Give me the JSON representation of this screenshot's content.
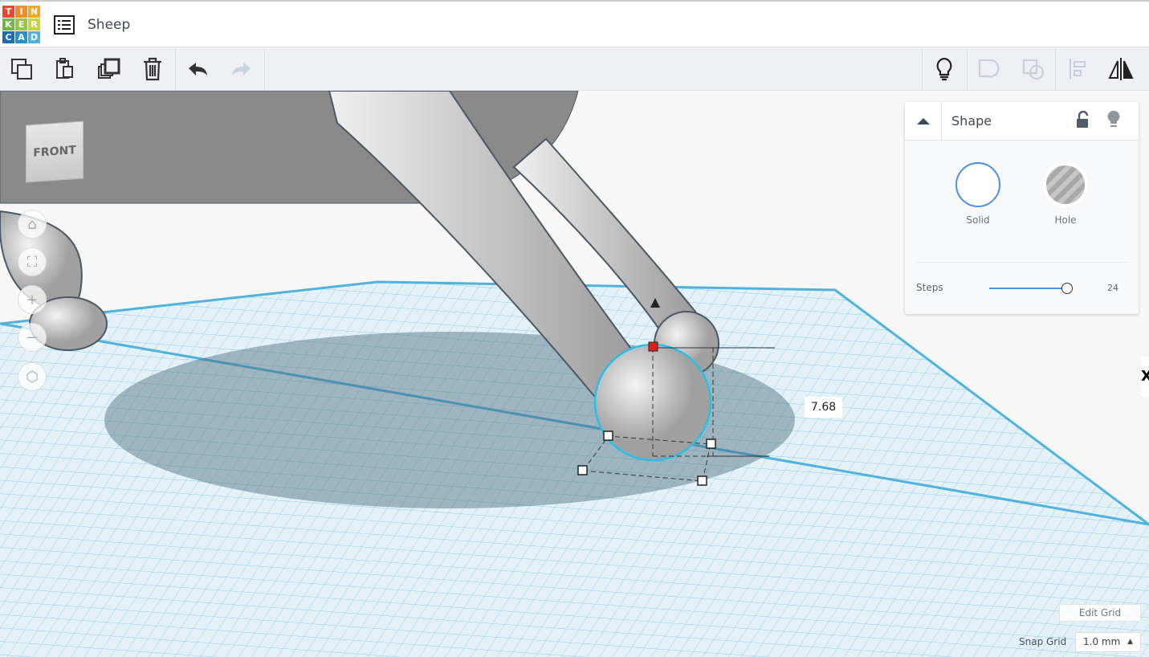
{
  "app": {
    "logo_letters": [
      "T",
      "I",
      "N",
      "K",
      "E",
      "R",
      "C",
      "A",
      "D"
    ],
    "logo_colors": [
      "#e8472b",
      "#f28b2c",
      "#f5a623",
      "#6cb944",
      "#97c83f",
      "#c8d43a",
      "#1c6db6",
      "#2e8bcc",
      "#55b0e0"
    ],
    "project_title": "Sheep"
  },
  "toolbar": {
    "left": [
      "copy-icon",
      "paste-icon",
      "duplicate-icon",
      "delete-icon",
      "undo-icon",
      "redo-icon"
    ],
    "right": [
      "light-bulb-icon",
      "group-icon",
      "ungroup-icon",
      "align-icon",
      "mirror-icon"
    ]
  },
  "view_cube": {
    "face_label": "FRONT"
  },
  "shape_panel": {
    "title": "Shape",
    "solid_label": "Solid",
    "hole_label": "Hole",
    "steps_label": "Steps",
    "steps_value": "24",
    "accent": "#4a90e2"
  },
  "viewport": {
    "dimension_value": "7.68",
    "edit_grid_label": "Edit Grid",
    "snap_grid_label": "Snap Grid",
    "snap_grid_value": "1.0 mm",
    "side_tab": "X"
  }
}
